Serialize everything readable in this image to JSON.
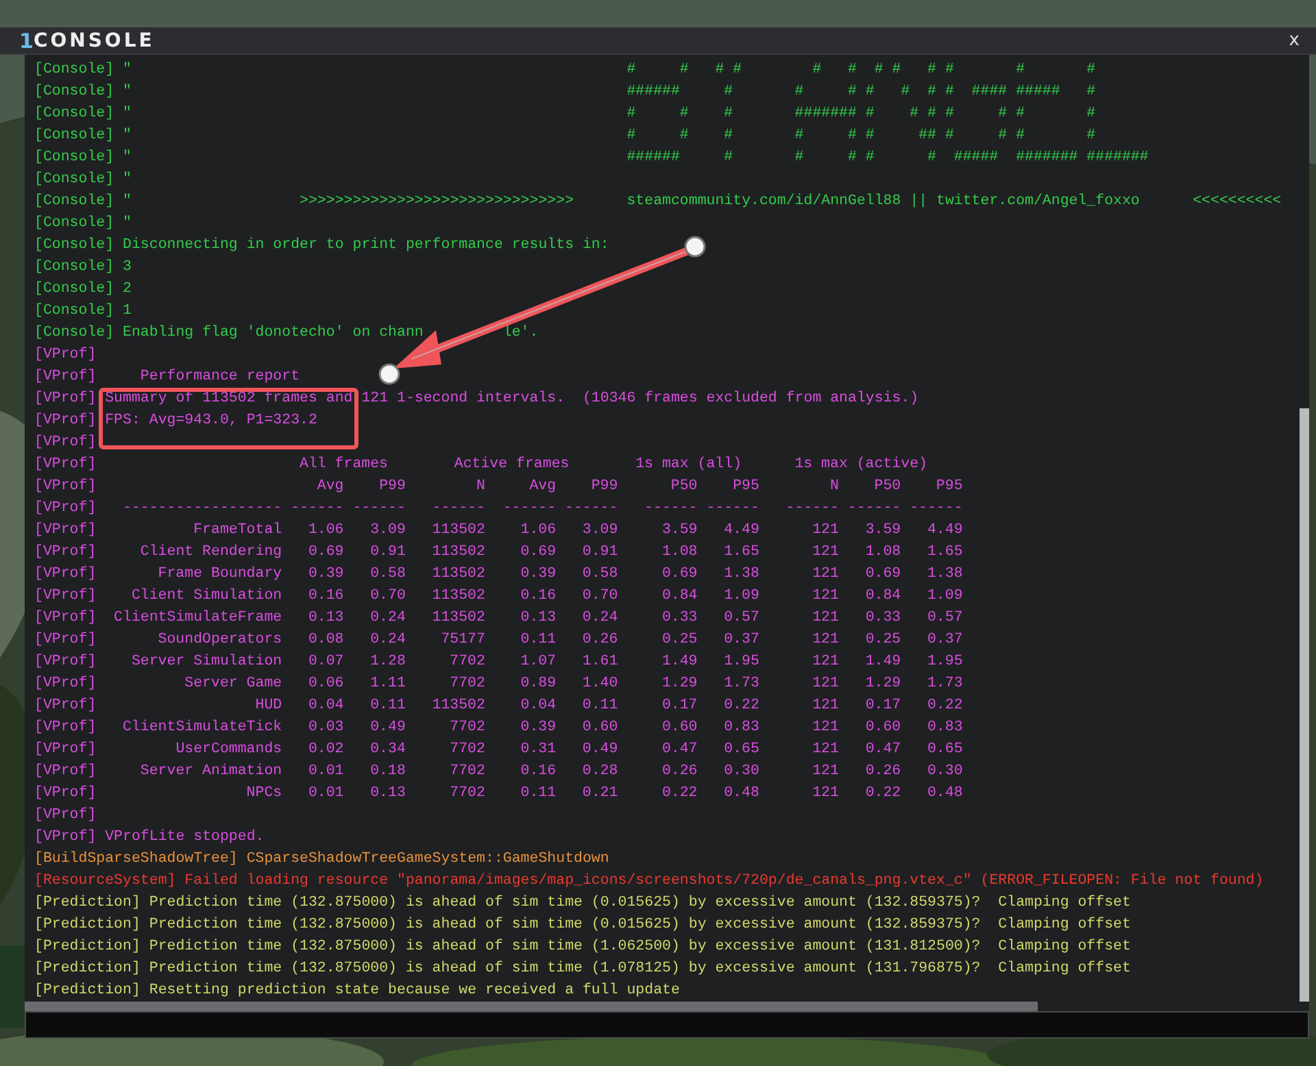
{
  "window": {
    "index": "1",
    "title": "CONSOLE",
    "close": "x"
  },
  "log_top": [
    {
      "kind": "console",
      "text": "[Console] \"                                                        #     #   # #        #   #  # #   # #       #       #"
    },
    {
      "kind": "console",
      "text": "[Console] \"                                                        ######     #       #     # #   #  # #  #### #####   #"
    },
    {
      "kind": "console",
      "text": "[Console] \"                                                        #     #    #       ####### #    # # #     # #       #"
    },
    {
      "kind": "console",
      "text": "[Console] \"                                                        #     #    #       #     # #     ## #     # #       #"
    },
    {
      "kind": "console",
      "text": "[Console] \"                                                        ######     #       #     # #      #  #####  ####### #######"
    },
    {
      "kind": "console",
      "text": "[Console] \""
    },
    {
      "kind": "console",
      "text": "[Console] \"                   >>>>>>>>>>>>>>>>>>>>>>>>>>>>>>>      steamcommunity.com/id/AnnGell88 || twitter.com/Angel_foxxo      <<<<<<<<<<"
    },
    {
      "kind": "console",
      "text": "[Console] \""
    },
    {
      "kind": "console",
      "text": "[Console] Disconnecting in order to print performance results in:"
    },
    {
      "kind": "console",
      "text": "[Console] 3"
    },
    {
      "kind": "console",
      "text": "[Console] 2"
    },
    {
      "kind": "console",
      "text": "[Console] 1"
    },
    {
      "kind": "console",
      "text": "[Console] Enabling flag 'donotecho' on chann         le'."
    },
    {
      "kind": "vprof",
      "text": "[VProf]"
    },
    {
      "kind": "vprof",
      "text": "[VProf]     Performance report"
    },
    {
      "kind": "vprof",
      "text": "[VProf] Summary of 113502 frames and 121 1-second intervals.  (10346 frames excluded from analysis.)"
    },
    {
      "kind": "vprof",
      "text": "[VProf] FPS: Avg=943.0, P1=323.2"
    },
    {
      "kind": "vprof",
      "text": "[VProf]"
    }
  ],
  "vprof_table": {
    "group_row": {
      "prefix": "[VProf]",
      "groups": [
        "All frames",
        "Active frames",
        "1s max (all)",
        "1s max (active)"
      ]
    },
    "column_row": {
      "prefix": "[VProf]",
      "columns": [
        "Avg",
        "P99",
        "N",
        "Avg",
        "P99",
        "P50",
        "P95",
        "N",
        "P50",
        "P95"
      ]
    },
    "rule_row": {
      "prefix": "[VProf]",
      "cells": [
        "------------------",
        "------",
        "------",
        "------",
        "------",
        "------",
        "------",
        "------",
        "------",
        "------",
        "------"
      ]
    },
    "rows": [
      {
        "prefix": "[VProf]",
        "name": "FrameTotal",
        "values": [
          "1.06",
          "3.09",
          "113502",
          "1.06",
          "3.09",
          "3.59",
          "4.49",
          "121",
          "3.59",
          "4.49"
        ]
      },
      {
        "prefix": "[VProf]",
        "name": "Client Rendering",
        "values": [
          "0.69",
          "0.91",
          "113502",
          "0.69",
          "0.91",
          "1.08",
          "1.65",
          "121",
          "1.08",
          "1.65"
        ]
      },
      {
        "prefix": "[VProf]",
        "name": "Frame Boundary",
        "values": [
          "0.39",
          "0.58",
          "113502",
          "0.39",
          "0.58",
          "0.69",
          "1.38",
          "121",
          "0.69",
          "1.38"
        ]
      },
      {
        "prefix": "[VProf]",
        "name": "Client Simulation",
        "values": [
          "0.16",
          "0.70",
          "113502",
          "0.16",
          "0.70",
          "0.84",
          "1.09",
          "121",
          "0.84",
          "1.09"
        ]
      },
      {
        "prefix": "[VProf]",
        "name": "ClientSimulateFrame",
        "values": [
          "0.13",
          "0.24",
          "113502",
          "0.13",
          "0.24",
          "0.33",
          "0.57",
          "121",
          "0.33",
          "0.57"
        ]
      },
      {
        "prefix": "[VProf]",
        "name": "SoundOperators",
        "values": [
          "0.08",
          "0.24",
          "75177",
          "0.11",
          "0.26",
          "0.25",
          "0.37",
          "121",
          "0.25",
          "0.37"
        ]
      },
      {
        "prefix": "[VProf]",
        "name": "Server Simulation",
        "values": [
          "0.07",
          "1.28",
          "7702",
          "1.07",
          "1.61",
          "1.49",
          "1.95",
          "121",
          "1.49",
          "1.95"
        ]
      },
      {
        "prefix": "[VProf]",
        "name": "Server Game",
        "values": [
          "0.06",
          "1.11",
          "7702",
          "0.89",
          "1.40",
          "1.29",
          "1.73",
          "121",
          "1.29",
          "1.73"
        ]
      },
      {
        "prefix": "[VProf]",
        "name": "HUD",
        "values": [
          "0.04",
          "0.11",
          "113502",
          "0.04",
          "0.11",
          "0.17",
          "0.22",
          "121",
          "0.17",
          "0.22"
        ]
      },
      {
        "prefix": "[VProf]",
        "name": "ClientSimulateTick",
        "values": [
          "0.03",
          "0.49",
          "7702",
          "0.39",
          "0.60",
          "0.60",
          "0.83",
          "121",
          "0.60",
          "0.83"
        ]
      },
      {
        "prefix": "[VProf]",
        "name": "UserCommands",
        "values": [
          "0.02",
          "0.34",
          "7702",
          "0.31",
          "0.49",
          "0.47",
          "0.65",
          "121",
          "0.47",
          "0.65"
        ]
      },
      {
        "prefix": "[VProf]",
        "name": "Server Animation",
        "values": [
          "0.01",
          "0.18",
          "7702",
          "0.16",
          "0.28",
          "0.26",
          "0.30",
          "121",
          "0.26",
          "0.30"
        ]
      },
      {
        "prefix": "[VProf]",
        "name": "NPCs",
        "values": [
          "0.01",
          "0.13",
          "7702",
          "0.11",
          "0.21",
          "0.22",
          "0.48",
          "121",
          "0.22",
          "0.48"
        ]
      }
    ]
  },
  "log_bottom": [
    {
      "kind": "vprof",
      "text": "[VProf]"
    },
    {
      "kind": "vprof",
      "text": "[VProf] VProfLite stopped."
    },
    {
      "kind": "build",
      "text": "[BuildSparseShadowTree] CSparseShadowTreeGameSystem::GameShutdown"
    },
    {
      "kind": "error",
      "text": "[ResourceSystem] Failed loading resource \"panorama/images/map_icons/screenshots/720p/de_canals_png.vtex_c\" (ERROR_FILEOPEN: File not found)"
    },
    {
      "kind": "prediction",
      "text": "[Prediction] Prediction time (132.875000) is ahead of sim time (0.015625) by excessive amount (132.859375)?  Clamping offset"
    },
    {
      "kind": "prediction",
      "text": "[Prediction] Prediction time (132.875000) is ahead of sim time (0.015625) by excessive amount (132.859375)?  Clamping offset"
    },
    {
      "kind": "prediction",
      "text": "[Prediction] Prediction time (132.875000) is ahead of sim time (1.062500) by excessive amount (131.812500)?  Clamping offset"
    },
    {
      "kind": "prediction",
      "text": "[Prediction] Prediction time (132.875000) is ahead of sim time (1.078125) by excessive amount (131.796875)?  Clamping offset"
    },
    {
      "kind": "prediction",
      "text": "[Prediction] Resetting prediction state because we received a full update"
    }
  ]
}
